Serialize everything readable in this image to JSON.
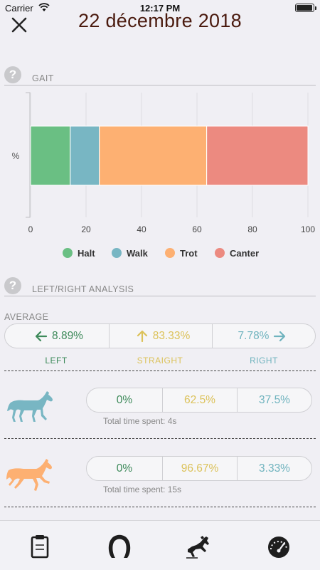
{
  "status_bar": {
    "carrier": "Carrier",
    "time": "12:17 PM"
  },
  "header": {
    "title": "22 décembre 2018",
    "close_icon": "close-icon"
  },
  "gait_section": {
    "help": "?",
    "label": "GAIT"
  },
  "chart_data": {
    "type": "bar",
    "orientation": "horizontal-stacked",
    "categories": [
      "%"
    ],
    "series": [
      {
        "name": "Halt",
        "values": [
          14.3
        ],
        "color": "#6abf83"
      },
      {
        "name": "Walk",
        "values": [
          10.5
        ],
        "color": "#78b6c3"
      },
      {
        "name": "Trot",
        "values": [
          38.7
        ],
        "color": "#fdb072"
      },
      {
        "name": "Canter",
        "values": [
          36.5
        ],
        "color": "#ec8a80"
      }
    ],
    "xlim": [
      0,
      100
    ],
    "xticks": [
      "0",
      "20",
      "40",
      "60",
      "80",
      "100"
    ],
    "grid": true,
    "legend": "bottom"
  },
  "lr_section": {
    "help": "?",
    "label": "LEFT/RIGHT ANALYSIS"
  },
  "average": {
    "label": "AVERAGE",
    "left": "8.89%",
    "straight": "83.33%",
    "right": "7.78%",
    "left_label": "LEFT",
    "straight_label": "STRAIGHT",
    "right_label": "RIGHT",
    "colors": {
      "left": "#3d8a5a",
      "straight": "#dcc25a",
      "right": "#6fb3be"
    }
  },
  "gaits": [
    {
      "icon": "walking-horse-icon",
      "color": "#78b6c3",
      "left": "0%",
      "straight": "62.5%",
      "right": "37.5%",
      "time_spent": "Total time spent: 4s"
    },
    {
      "icon": "trotting-horse-icon",
      "color": "#fdb072",
      "left": "0%",
      "straight": "96.67%",
      "right": "3.33%",
      "time_spent": "Total time spent: 15s"
    }
  ],
  "tabbar": {
    "items": [
      {
        "icon": "clipboard-icon"
      },
      {
        "icon": "horseshoe-icon"
      },
      {
        "icon": "jumping-horse-icon"
      },
      {
        "icon": "speedometer-icon"
      }
    ]
  }
}
